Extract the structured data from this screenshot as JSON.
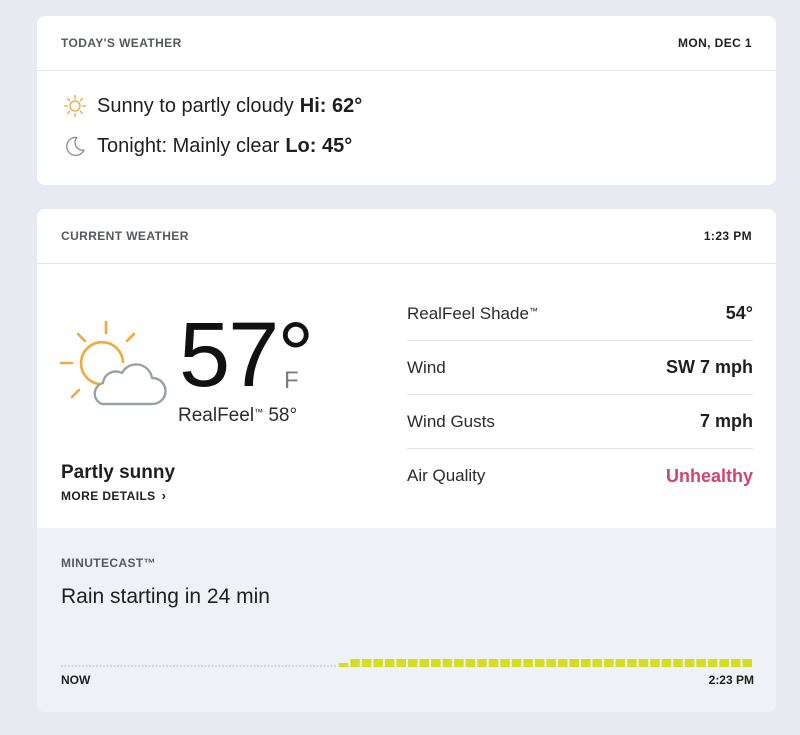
{
  "today": {
    "label": "TODAY'S WEATHER",
    "date": "MON, DEC 1",
    "day": {
      "icon": "sun-outline-icon",
      "text": "Sunny to partly cloudy",
      "hi_label": "Hi: 62°"
    },
    "night": {
      "icon": "moon-icon",
      "text": "Tonight: Mainly clear",
      "lo_label": "Lo: 45°"
    }
  },
  "current": {
    "label": "CURRENT WEATHER",
    "time": "1:23 PM",
    "icon": "sun-cloud-icon",
    "temp": "57°",
    "unit": "F",
    "realfeel_label": "RealFeel",
    "realfeel_mark": "™",
    "realfeel_value": "58°",
    "phrase": "Partly sunny",
    "more_details": "MORE DETAILS",
    "details": [
      {
        "label": "RealFeel Shade",
        "mark": "™",
        "value": "54°"
      },
      {
        "label": "Wind",
        "value": "SW 7 mph"
      },
      {
        "label": "Wind Gusts",
        "value": "7 mph"
      },
      {
        "label": "Air Quality",
        "value": "Unhealthy",
        "status_color": "#d2436b"
      }
    ]
  },
  "minutecast": {
    "label": "MINUTECAST™",
    "summary": "Rain starting in 24 min",
    "start_label": "NOW",
    "end_label": "2:23 PM",
    "rain_start_minute": 24,
    "total_minutes": 60,
    "rain_color": "#d4dd1e",
    "dry_color": "#c9cdd3"
  }
}
